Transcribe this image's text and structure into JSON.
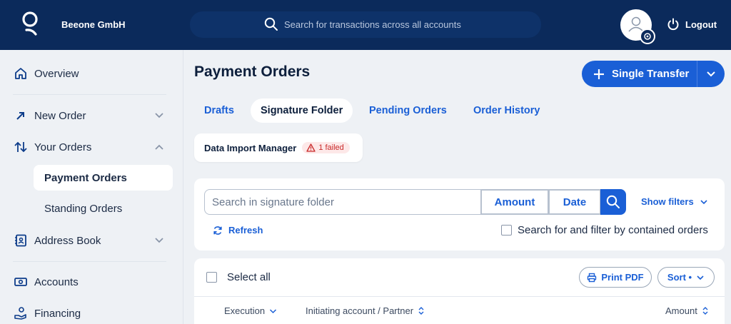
{
  "header": {
    "company": "Beeone GmbH",
    "search_placeholder": "Search for transactions across all accounts",
    "logout_label": "Logout"
  },
  "sidebar": {
    "items": [
      {
        "label": "Overview",
        "icon": "home-icon"
      },
      {
        "label": "New Order",
        "icon": "arrow-up-right-icon"
      },
      {
        "label": "Your Orders",
        "icon": "arrows-up-down-icon"
      },
      {
        "label": "Payment Orders"
      },
      {
        "label": "Standing Orders"
      },
      {
        "label": "Address Book",
        "icon": "address-book-icon"
      },
      {
        "label": "Accounts",
        "icon": "cash-icon"
      },
      {
        "label": "Financing",
        "icon": "hand-coin-icon"
      }
    ]
  },
  "main": {
    "title": "Payment Orders",
    "single_transfer_label": "Single Transfer",
    "tabs": [
      {
        "label": "Drafts"
      },
      {
        "label": "Signature Folder",
        "active": true
      },
      {
        "label": "Pending Orders"
      },
      {
        "label": "Order History"
      }
    ],
    "import_manager": {
      "label": "Data Import Manager",
      "status": "1 failed"
    },
    "filter": {
      "search_placeholder": "Search in signature folder",
      "amount_label": "Amount",
      "date_label": "Date",
      "show_filters_label": "Show filters",
      "refresh_label": "Refresh",
      "contained_label": "Search for and filter by contained orders"
    },
    "list": {
      "select_all_label": "Select all",
      "print_pdf_label": "Print PDF",
      "sort_label": "Sort •",
      "columns": [
        "Execution",
        "Initiating account / Partner",
        "Amount"
      ]
    }
  },
  "colors": {
    "header_bg": "#0b2a5b",
    "accent": "#1a5fd6",
    "error": "#c92a2a"
  }
}
